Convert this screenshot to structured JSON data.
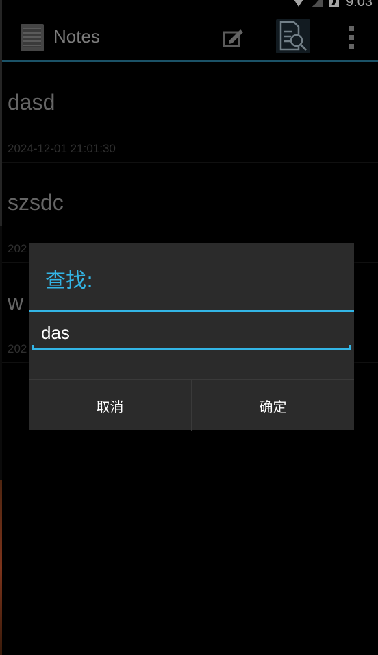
{
  "status_bar": {
    "time": "9:03"
  },
  "action_bar": {
    "title": "Notes",
    "icons": [
      "notes-app-icon",
      "compose-icon",
      "search-document-icon",
      "overflow-menu-icon"
    ],
    "accent_color": "#2a7e9e"
  },
  "notes": [
    {
      "title": "dasd",
      "date": "2024-12-01 21:01:30"
    },
    {
      "title": "szsdc",
      "date": "202"
    },
    {
      "title": "w",
      "date": "202"
    }
  ],
  "dialog": {
    "title": "查找:",
    "input_value": "das",
    "cancel_label": "取消",
    "confirm_label": "确定",
    "accent_color": "#33b5e5"
  }
}
